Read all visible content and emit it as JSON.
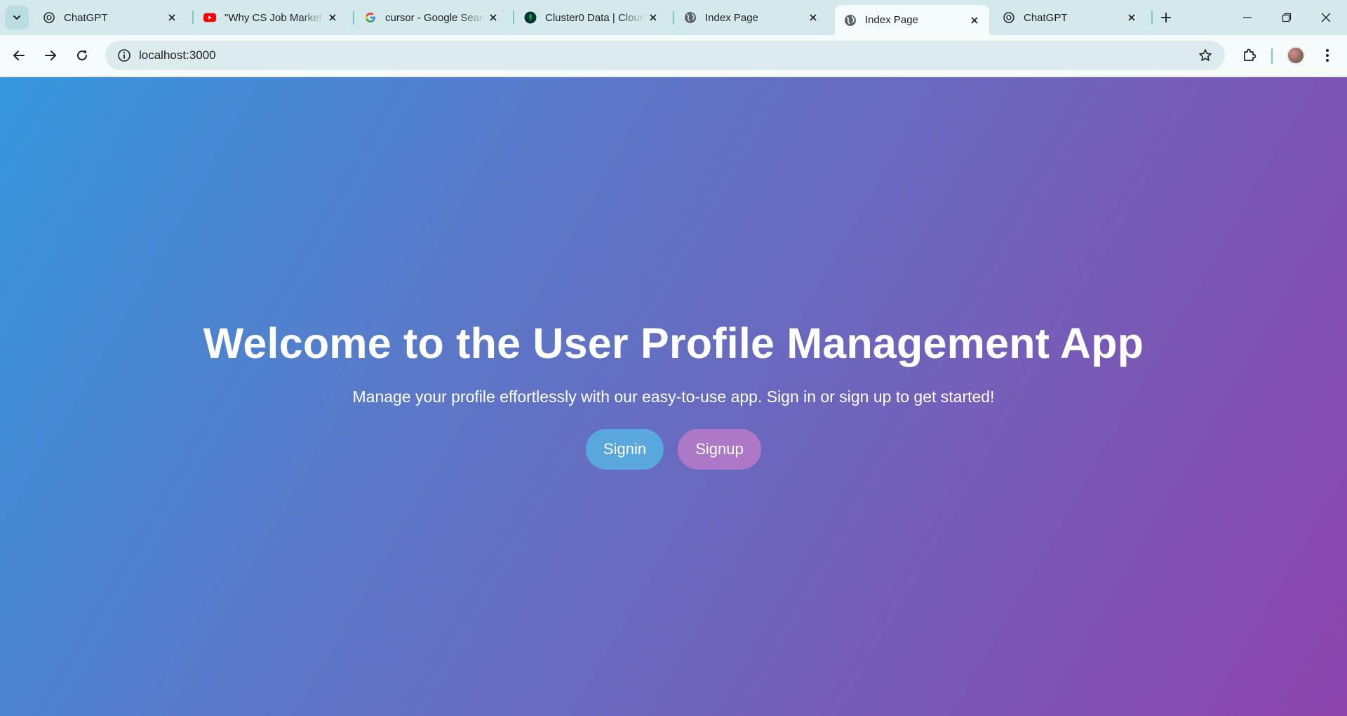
{
  "browser": {
    "tabs": [
      {
        "title": "ChatGPT",
        "icon": "chatgpt-icon",
        "active": false
      },
      {
        "title": "\"Why CS Job Market",
        "icon": "youtube-icon",
        "active": false
      },
      {
        "title": "cursor - Google Searc",
        "icon": "google-icon",
        "active": false
      },
      {
        "title": "Cluster0 Data | Cloud",
        "icon": "mongodb-icon",
        "active": false
      },
      {
        "title": "Index Page",
        "icon": "globe-icon",
        "active": false
      },
      {
        "title": "Index Page",
        "icon": "globe-icon",
        "active": true
      },
      {
        "title": "ChatGPT",
        "icon": "chatgpt-icon",
        "active": false
      }
    ],
    "url": "localhost:3000",
    "colors": {
      "youtube": "#ff0000",
      "mongodb": "#13aa52",
      "tab_separator": "#7ac6d0"
    }
  },
  "page": {
    "title": "Welcome to the User Profile Management App",
    "subtitle": "Manage your profile effortlessly with our easy-to-use app. Sign in or sign up to get started!",
    "signin_label": "Signin",
    "signup_label": "Signup",
    "colors": {
      "gradient_start": "#3597dc",
      "gradient_end": "#8c44ab",
      "signin_button": "#58a7dd",
      "signup_button": "#ad78c6"
    }
  }
}
